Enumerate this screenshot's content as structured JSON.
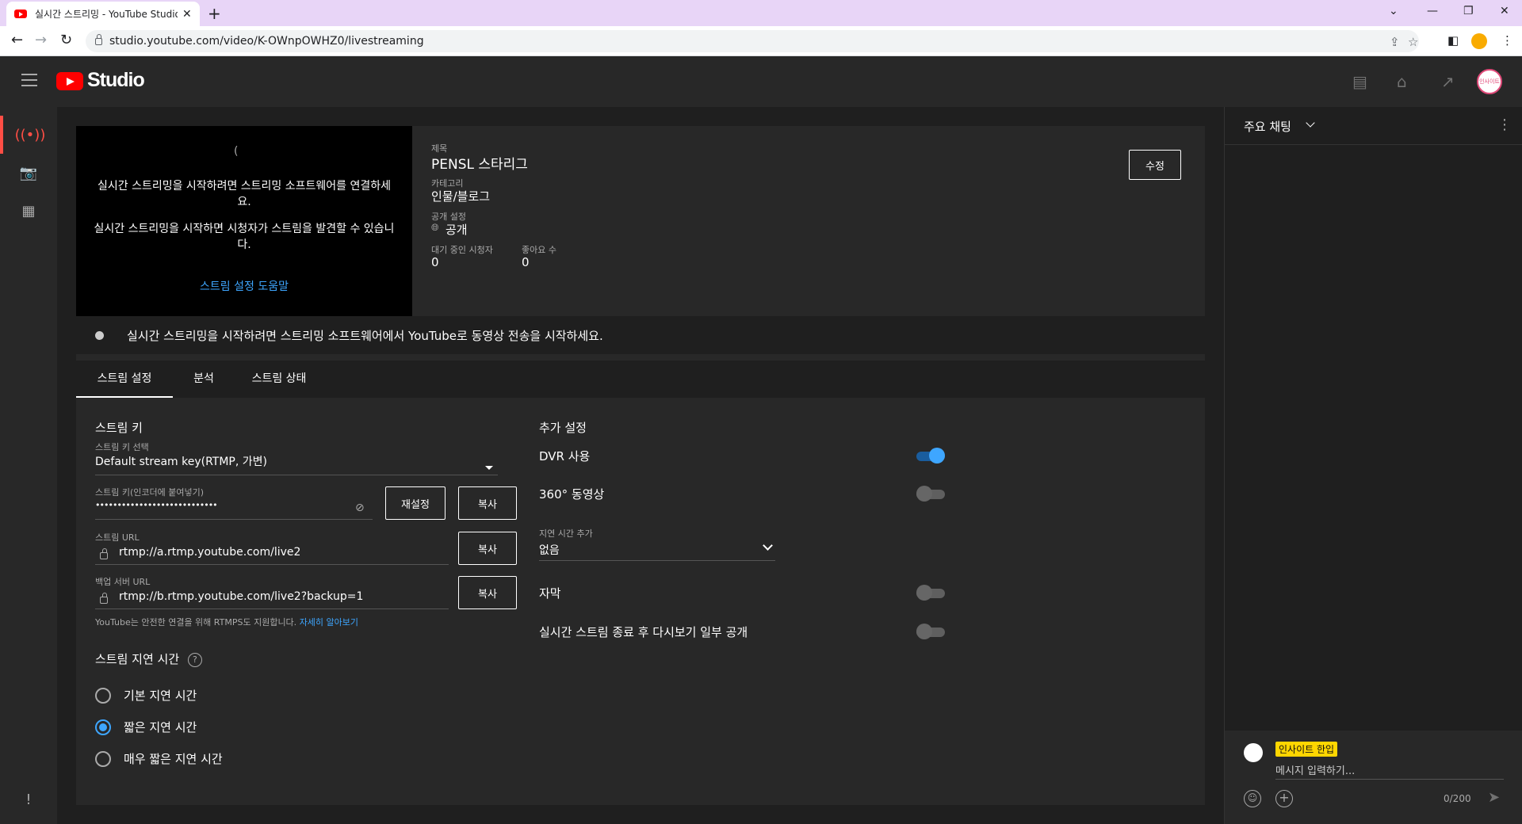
{
  "browser": {
    "tab_title": "실시간 스트리밍 - YouTube Studio",
    "url": "studio.youtube.com/video/K-OWnpOWHZ0/livestreaming"
  },
  "header": {
    "logo_text": "Studio",
    "avatar_text": "인사이트"
  },
  "video": {
    "preview_msg1": "실시간 스트리밍을 시작하려면 스트리밍 소프트웨어를 연결하세요.",
    "preview_msg2": "실시간 스트리밍을 시작하면 시청자가 스트림을 발견할 수 있습니다.",
    "preview_link": "스트림 설정 도움말",
    "title_label": "제목",
    "title": "PENSL 스타리그",
    "category_label": "카테고리",
    "category": "인물/블로그",
    "visibility_label": "공개 설정",
    "visibility": "공개",
    "waiting_label": "대기 중인 시청자",
    "waiting": "0",
    "likes_label": "좋아요 수",
    "likes": "0",
    "edit_label": "수정"
  },
  "status_message": "실시간 스트리밍을 시작하려면 스트리밍 소프트웨어에서 YouTube로 동영상 전송을 시작하세요.",
  "tabs": [
    "스트림 설정",
    "분석",
    "스트림 상태"
  ],
  "stream": {
    "section_title": "스트림 키",
    "key_select_label": "스트림 키 선택",
    "key_select_value": "Default stream key(RTMP, 가변)",
    "key_label": "스트림 키(인코더에 붙여넣기)",
    "key_value": "••••••••••••••••••••••••••••",
    "reset_label": "재설정",
    "copy_label": "복사",
    "url_label": "스트림 URL",
    "url_value": "rtmp://a.rtmp.youtube.com/live2",
    "backup_label": "백업 서버 URL",
    "backup_value": "rtmp://b.rtmp.youtube.com/live2?backup=1",
    "hint": "YouTube는 안전한 연결을 위해 RTMPS도 지원합니다.",
    "hint_link": "자세히 알아보기"
  },
  "latency": {
    "title": "스트림 지연 시간",
    "options": [
      "기본 지연 시간",
      "짧은 지연 시간",
      "매우 짧은 지연 시간"
    ],
    "selected": 1
  },
  "extra": {
    "title": "추가 설정",
    "dvr_label": "DVR 사용",
    "dvr_on": true,
    "video360_label": "360° 동영상",
    "video360_on": false,
    "delay_label": "지연 시간 추가",
    "delay_value": "없음",
    "captions_label": "자막",
    "captions_on": false,
    "replay_label": "실시간 스트림 종료 후 다시보기 일부 공개",
    "replay_on": false
  },
  "chat": {
    "title": "주요 채팅",
    "user_name": "인사이트 한입",
    "placeholder": "메시지 입력하기...",
    "counter": "0/200"
  },
  "colors": {
    "accent_red": "#ff0000",
    "link_blue": "#3ea6ff",
    "toggle_on": "#3ea6ff"
  }
}
